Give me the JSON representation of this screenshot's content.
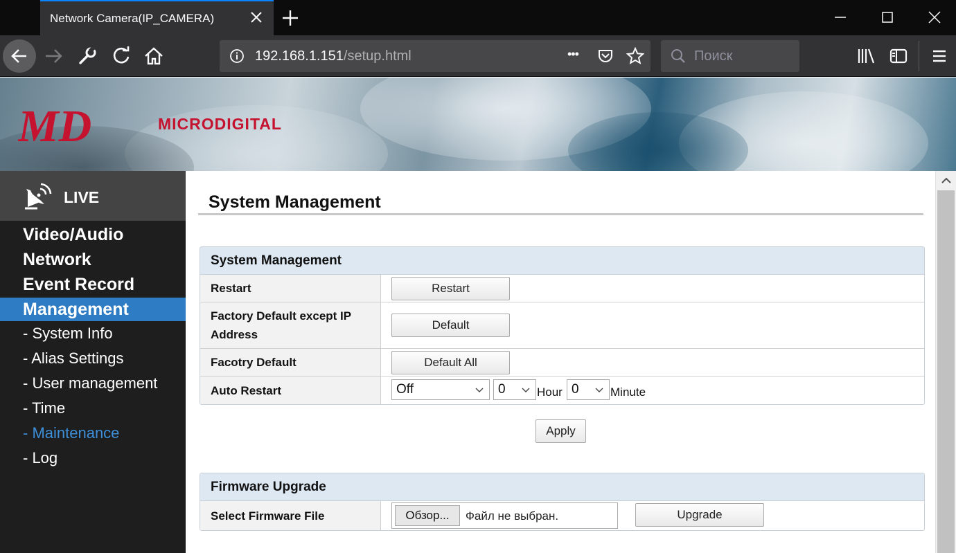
{
  "browser": {
    "tab_title": "Network Camera(IP_CAMERA)",
    "url_host": "192.168.1.151",
    "url_path": "/setup.html",
    "search_placeholder": "Поиск",
    "url_dots": "•••"
  },
  "header": {
    "brand_text": "MICRODIGITAL",
    "logo_text": "MD",
    "brand_color": "#c4122f"
  },
  "sidebar": {
    "live_label": "LIVE",
    "menu": [
      {
        "label": "Video/Audio",
        "active": false
      },
      {
        "label": "Network",
        "active": false
      },
      {
        "label": "Event Record",
        "active": false
      },
      {
        "label": "Management",
        "active": true
      }
    ],
    "submenu": [
      {
        "label": "- System Info",
        "active": false
      },
      {
        "label": "- Alias Settings",
        "active": false
      },
      {
        "label": "- User management",
        "active": false
      },
      {
        "label": "- Time",
        "active": false
      },
      {
        "label": "- Maintenance",
        "active": true
      },
      {
        "label": "- Log",
        "active": false
      }
    ],
    "active_color": "#2e7cc4"
  },
  "main": {
    "page_title": "System Management",
    "system_panel": {
      "title": "System Management",
      "restart_label": "Restart",
      "restart_button": "Restart",
      "factory_label": "Factory Default except IP Address",
      "factory_button": "Default",
      "factory_all_label": "Facotry Default",
      "factory_all_button": "Default All",
      "auto_restart_label": "Auto Restart",
      "auto_restart_mode": "Off",
      "auto_restart_hour": "0",
      "hour_unit": "Hour",
      "auto_restart_minute": "0",
      "minute_unit": "Minute"
    },
    "apply_button": "Apply",
    "firmware_panel": {
      "title": "Firmware Upgrade",
      "file_label": "Select Firmware File",
      "browse_button": "Обзор...",
      "file_status": "Файл не выбран.",
      "upgrade_button": "Upgrade"
    }
  },
  "icons": {
    "back": "arrow-left-icon",
    "forward": "arrow-right-icon",
    "tools": "wrench-icon",
    "reload": "reload-icon",
    "home": "home-icon",
    "info": "info-icon",
    "pocket": "pocket-icon",
    "bookmark": "star-icon",
    "search": "search-icon",
    "library": "library-icon",
    "sidebar": "sidebar-icon",
    "menu": "hamburger-icon",
    "live": "satellite-dish-icon"
  }
}
